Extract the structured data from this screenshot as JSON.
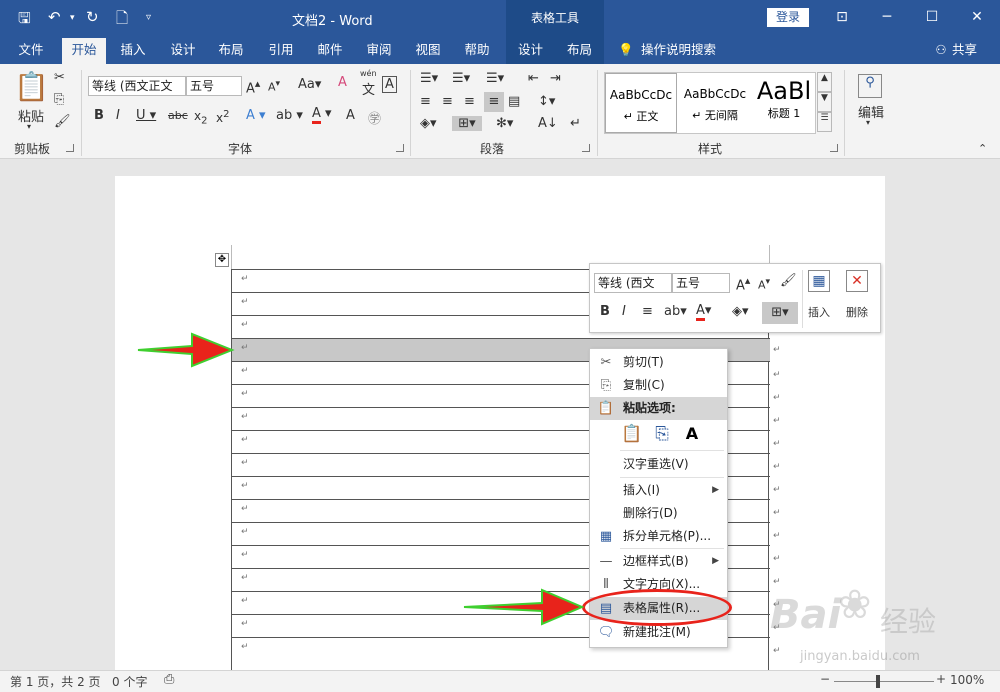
{
  "titlebar": {
    "title": "文档2  -  Word",
    "context_tools": "表格工具",
    "login_button": "登录"
  },
  "tabs": [
    "文件",
    "开始",
    "插入",
    "设计",
    "布局",
    "引用",
    "邮件",
    "审阅",
    "视图",
    "帮助",
    "设计",
    "布局"
  ],
  "tell_me": "操作说明搜索",
  "share": "共享",
  "ribbon": {
    "clipboard": {
      "paste": "粘贴",
      "label": "剪贴板"
    },
    "font": {
      "font_name": "等线 (西文正文",
      "font_size": "五号",
      "label": "字体",
      "wen": "wén"
    },
    "paragraph": {
      "label": "段落"
    },
    "styles": {
      "label": "样式",
      "items": [
        {
          "preview": "AaBbCcDc",
          "name": "↵ 正文"
        },
        {
          "preview": "AaBbCcDc",
          "name": "↵ 无间隔"
        },
        {
          "preview": "AaBl",
          "name": "标题 1"
        }
      ]
    },
    "editing": {
      "label": "编辑"
    }
  },
  "minitoolbar": {
    "font_name": "等线 (西文",
    "font_size": "五号",
    "insert": "插入",
    "delete": "删除"
  },
  "context_menu": {
    "cut": "剪切(T)",
    "copy": "复制(C)",
    "paste_options": "粘贴选项:",
    "reconvert": "汉字重选(V)",
    "insert": "插入(I)",
    "delete_row": "删除行(D)",
    "split_cells": "拆分单元格(P)...",
    "border_styles": "边框样式(B)",
    "text_direction": "文字方向(X)...",
    "table_properties": "表格属性(R)...",
    "new_comment": "新建批注(M)"
  },
  "cell_mark": "↵",
  "statusbar": {
    "page": "第 1 页，共 2 页",
    "words": "0 个字",
    "zoom": "100%"
  },
  "watermark": {
    "brand": "Bai",
    "brand2": "经验",
    "url": "jingyan.baidu.com"
  },
  "colors": {
    "accent": "#2b579a",
    "arrow": "#e8231b",
    "highlight": "#e8231b"
  }
}
